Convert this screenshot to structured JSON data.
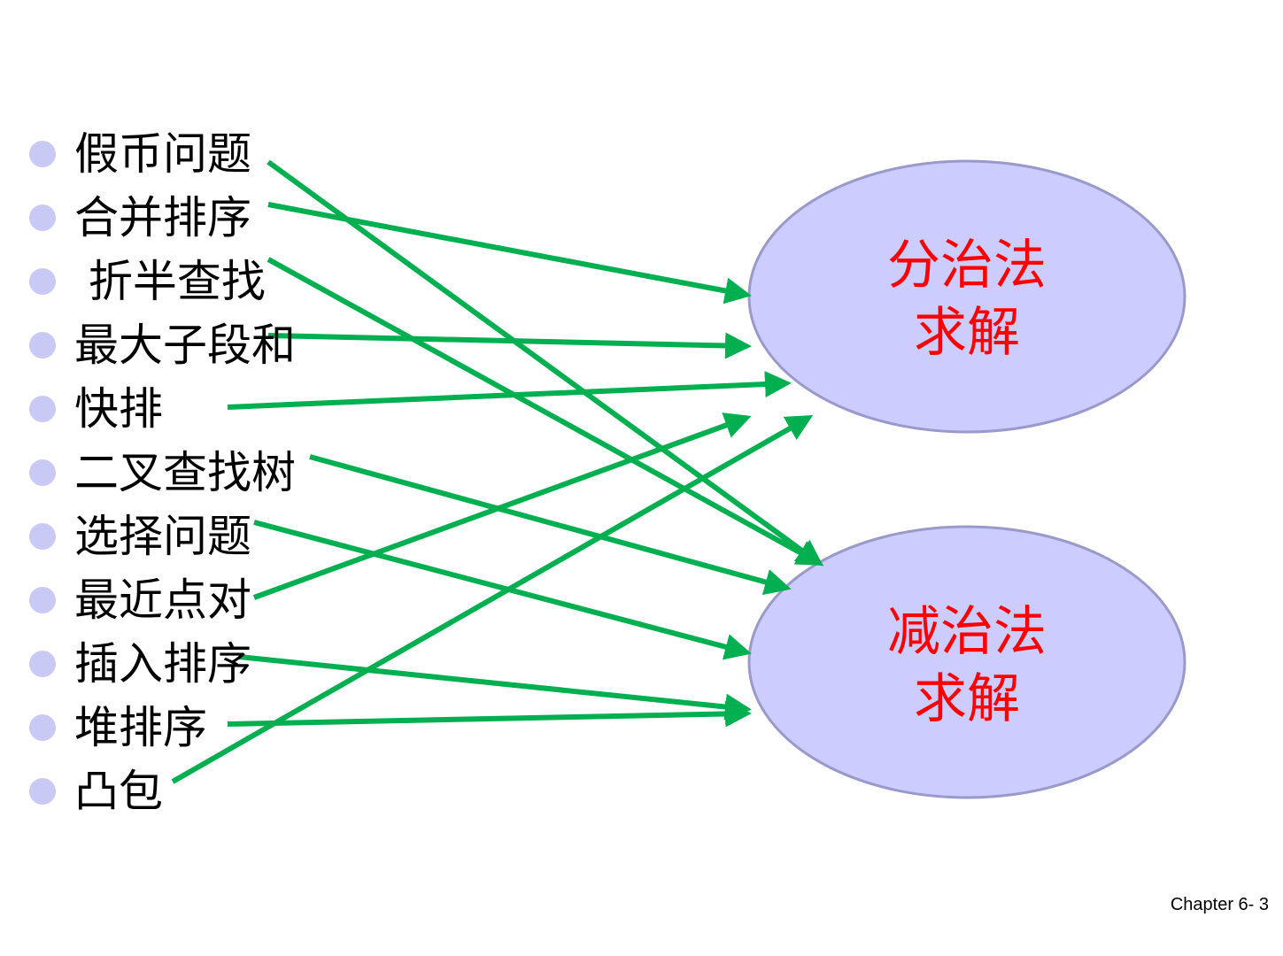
{
  "items": [
    "假币问题",
    "合并排序",
    " 折半查找",
    "最大子段和",
    "快排",
    "二叉查找树",
    "选择问题",
    "最近点对",
    "插入排序",
    "堆排序",
    "凸包"
  ],
  "divide_conquer": {
    "line1": "分治法",
    "line2": "求解"
  },
  "decrease_conquer": {
    "line1": "减治法",
    "line2": "求解"
  },
  "footer": "Chapter 6- 3",
  "colors": {
    "arrow": "#00b050",
    "ellipse_fill": "#ccccff",
    "ellipse_stroke": "#9999cc",
    "label": "#ff0000",
    "bullet": "#c9c9f5"
  },
  "mapping": {
    "假币问题": "减治法",
    "合并排序": "分治法",
    "折半查找": "减治法",
    "最大子段和": "分治法",
    "快排": "分治法",
    "二叉查找树": "减治法",
    "选择问题": "减治法",
    "最近点对": "分治法",
    "插入排序": "减治法",
    "堆排序": "减治法",
    "凸包": "分治法"
  }
}
